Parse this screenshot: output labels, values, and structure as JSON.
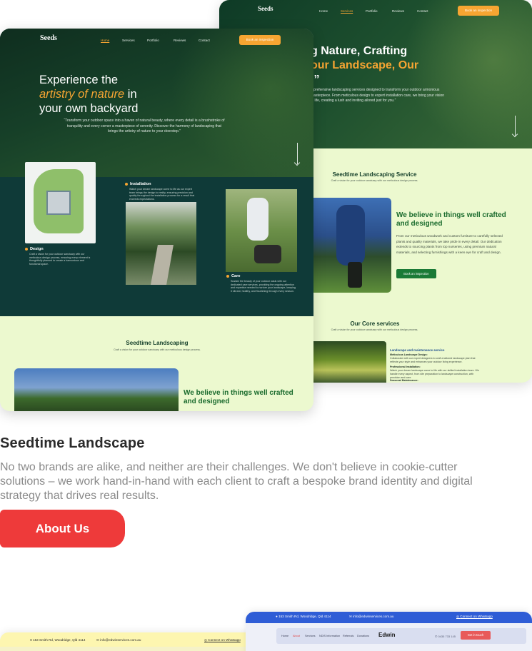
{
  "back_mockup": {
    "logo": "Seeds",
    "nav": [
      "Home",
      "Services",
      "Portfolio",
      "Reviews",
      "Contact"
    ],
    "cta": "Book an inspection",
    "headline_line1": "g Nature, Crafting",
    "headline_line2": "our Landscape, Our",
    "headline_line3": ".”",
    "desc": "mprehensive landscaping services designed to transform your outdoor armonious masterpiece. From meticulous design to expert installation care, we bring your vision to life, creating a lush and inviting ailored just for you.”",
    "service_title": "Seedtime Landscaping Service",
    "service_sub": "Craft a vision for your outdoor sanctuary with our meticulous design process.",
    "believe_title": "We believe in things well crafted and designed",
    "believe_desc": "From our meticulous woodwork and custom furniture to carefully selected plants and quality materials, we take pride in every detail. Our dedication extends to sourcing plants from top nurseries, using premium natural materials, and selecting furnishings with a keen eye for craft and design.",
    "believe_button": "Book an inspection",
    "core_title": "Our Core services",
    "core_sub": "Craft a vision for your outdoor sanctuary with our meticulous design process.",
    "core_heading": "Landscape and maintenance service",
    "core_items": [
      {
        "title": "Meticulous Landscape Design:",
        "text": "Collaborate with our expert designers to craft a tailored landscape plan that reflects your style and enhances your outdoor living experience."
      },
      {
        "title": "Professional Installation:",
        "text": "Watch your dream landscape come to life with our skilled installation team. We handle every aspect, from site preparation to landscape construction, with precision and care."
      },
      {
        "title": "Seasonal Maintenance:",
        "text": ""
      }
    ]
  },
  "front_mockup": {
    "logo": "Seeds",
    "nav": [
      "Home",
      "Services",
      "Portfolio",
      "Reviews",
      "Contact"
    ],
    "cta": "Book an inspection",
    "headline_a": "Experience the",
    "headline_b": "artistry of nature",
    "headline_c": " in",
    "headline_d": "your own backyard",
    "quote": "“Transform your outdoor space into a haven of natural beauty, where every detail is a brushstroke of tranquility and every corner a masterpiece of serenity. Discover the harmony of landscaping that brings the artistry of nature to your doorstep.”",
    "steps": [
      {
        "title": "Design",
        "desc": "Craft a vision for your outdoor sanctuary with our meticulous design process, ensuring every element is thoughtfully planned to create a harmonious and functional space."
      },
      {
        "title": "Installation",
        "desc": "Watch your dream landscape come to life as our expert team brings the design to reality, ensuring precision and quality throughout the installation process for a result that exceeds expectations."
      },
      {
        "title": "Care",
        "desc": "Sustain the beauty of your outdoor oasis with our dedicated care services, providing the ongoing attention and expertise needed to nurture your landscape, keeping it vibrant, healthy, and flourishing through every season."
      }
    ],
    "seed_title": "Seedtime Landscaping",
    "seed_sub": "Craft a vision for your outdoor sanctuary with our meticulous design process.",
    "believe_title": "We believe in things well crafted and designed"
  },
  "section": {
    "title": "Seedtime Landscape",
    "body": "No two brands are alike, and neither are their challenges. We don't believe in cookie-cutter solutions – we work hand-in-hand with each client to craft a bespoke brand identity and digital strategy that drives real results.",
    "button": "About Us"
  },
  "bottom_left": {
    "address": "153 Smith Rd, Woodridge, Qld 4114",
    "email": "info@edwinservices.com.au",
    "whatsapp": "Connect on Whatsapp"
  },
  "bottom_right": {
    "address": "153 Smith Rd, Woodridge, Qld 4114",
    "email": "info@edwinservices.com.au",
    "whatsapp": "Connect on Whatsapp",
    "nav": [
      "Home",
      "About",
      "Services",
      "NDIS Information",
      "Referrals",
      "Donations"
    ],
    "logo": "Edwin",
    "phone": "0435 733 145",
    "cta": "Get in touch"
  },
  "colors": {
    "accent_orange": "#f7a532",
    "dark_green": "#0f3a38",
    "light_green": "#ecf9cf",
    "brand_green": "#1a6b2d",
    "about_button": "#ee3a3a"
  }
}
